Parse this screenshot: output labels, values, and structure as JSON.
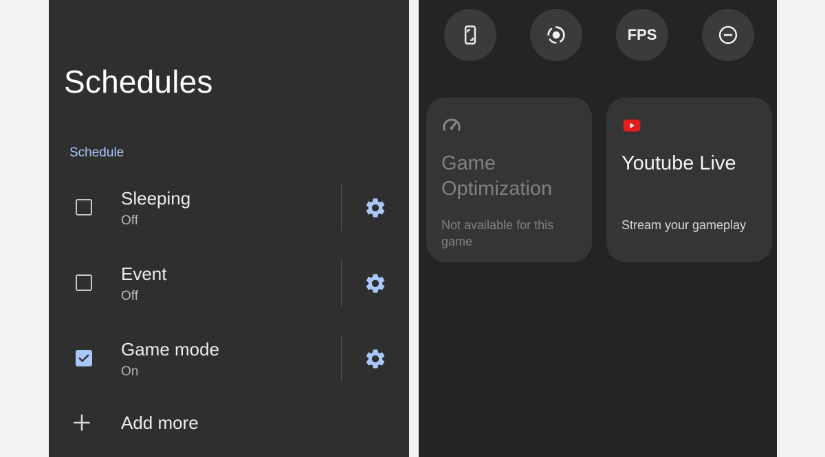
{
  "left": {
    "title": "Schedules",
    "section": "Schedule",
    "items": [
      {
        "name": "Sleeping",
        "status": "Off",
        "checked": false
      },
      {
        "name": "Event",
        "status": "Off",
        "checked": false
      },
      {
        "name": "Game mode",
        "status": "On",
        "checked": true
      }
    ],
    "add_more": "Add more"
  },
  "right": {
    "quick_buttons": [
      "phone-rotate-icon",
      "record-icon",
      "FPS",
      "do-not-disturb-icon"
    ],
    "cards": [
      {
        "title": "Game Optimization",
        "subtitle": "Not available for this game",
        "icon": "speedometer-icon"
      },
      {
        "title": "Youtube Live",
        "subtitle": "Stream your gameplay",
        "icon": "youtube-icon"
      }
    ]
  },
  "colors": {
    "accent": "#a8c7fa",
    "youtube_red": "#e11d1d"
  }
}
